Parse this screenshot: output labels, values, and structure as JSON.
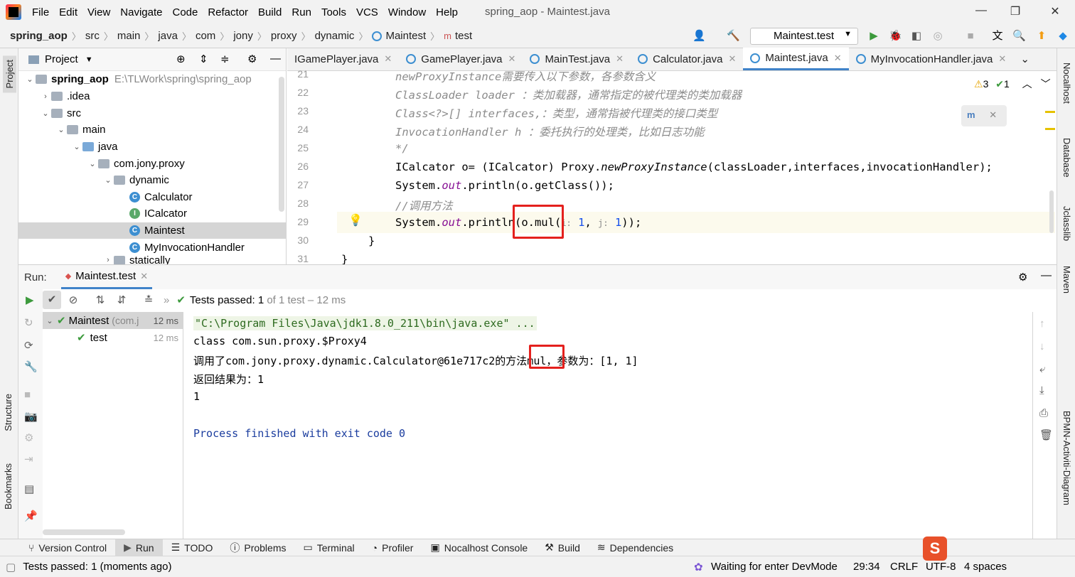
{
  "menu": [
    "File",
    "Edit",
    "View",
    "Navigate",
    "Code",
    "Refactor",
    "Build",
    "Run",
    "Tools",
    "VCS",
    "Window",
    "Help"
  ],
  "window_title": "spring_aop - Maintest.java",
  "breadcrumbs": [
    "spring_aop",
    "src",
    "main",
    "java",
    "com",
    "jony",
    "proxy",
    "dynamic",
    "Maintest",
    "test"
  ],
  "run_config": "Maintest.test",
  "project_panel": {
    "title": "Project",
    "tree": [
      {
        "label": "spring_aop",
        "extra": "E:\\TLWork\\spring\\spring_aop"
      },
      {
        "label": ".idea"
      },
      {
        "label": "src"
      },
      {
        "label": "main"
      },
      {
        "label": "java"
      },
      {
        "label": "com.jony.proxy"
      },
      {
        "label": "dynamic"
      },
      {
        "label": "Calculator"
      },
      {
        "label": "ICalcator"
      },
      {
        "label": "Maintest"
      },
      {
        "label": "MyInvocationHandler"
      },
      {
        "label": "statically"
      }
    ]
  },
  "editor_tabs": [
    "IGamePlayer.java",
    "GamePlayer.java",
    "MainTest.java",
    "Calculator.java",
    "Maintest.java",
    "MyInvocationHandler.java"
  ],
  "inspections": {
    "warnings": "3",
    "ok": "1"
  },
  "code_lines": [
    {
      "n": "21",
      "text": "newProxyInstance需要传入以下参数，各参数含义"
    },
    {
      "n": "22",
      "text": "ClassLoader loader ：类加载器，通常指定的被代理类的类加载器"
    },
    {
      "n": "23",
      "text": "Class<?>[] interfaces,：类型，通常指被代理类的接口类型"
    },
    {
      "n": "24",
      "text": "InvocationHandler h ：委托执行的处理类，比如日志功能"
    },
    {
      "n": "25",
      "text": "*/"
    },
    {
      "n": "26",
      "a": "ICalcator o= (ICalcator) Proxy.",
      "b": "newProxyInstance",
      "c": "(classLoader,interfaces,invocationHandler);"
    },
    {
      "n": "27",
      "a": "System.",
      "b": "out",
      "c": ".println(o.getClass());"
    },
    {
      "n": "28",
      "text": "//调用方法"
    },
    {
      "n": "29",
      "a": "System.",
      "b": "out",
      "c": ".println(o.mul(",
      "h1": "i:",
      "v1": "1",
      ",": ",",
      "h2": "j:",
      "v2": "1",
      "end": "));"
    },
    {
      "n": "30",
      "text": "}"
    },
    {
      "n": "31",
      "text": "}"
    }
  ],
  "run_panel": {
    "label": "Run:",
    "tab": "Maintest.test",
    "status": "Tests passed:",
    "status_count": "1",
    "status_rest": "of 1 test – 12 ms",
    "tests": [
      {
        "name": "Maintest",
        "pkg": "(com.j",
        "time": "12 ms"
      },
      {
        "name": "test",
        "time": "12 ms"
      }
    ],
    "console": [
      "\"C:\\Program Files\\Java\\jdk1.8.0_211\\bin\\java.exe\" ...",
      "class com.sun.proxy.$Proxy4",
      "调用了com.jony.proxy.dynamic.Calculator@61e717c2的方法mul，参数为：[1, 1]",
      "返回结果为：1",
      "1",
      "",
      "Process finished with exit code 0"
    ]
  },
  "bottom_tabs": [
    "Version Control",
    "Run",
    "TODO",
    "Problems",
    "Terminal",
    "Profiler",
    "Nocalhost Console",
    "Build",
    "Dependencies"
  ],
  "status_bar": {
    "message": "Tests passed: 1 (moments ago)",
    "devmode": "Waiting for enter DevMode",
    "position": "29:34",
    "line_sep": "CRLF",
    "encoding": "UTF-8",
    "indent": "4 spaces"
  },
  "right_tools": [
    "Nocalhost",
    "Database",
    "Jclasslib",
    "Maven",
    "BPMN-Activiti-Diagram"
  ],
  "left_tools": [
    "Project",
    "Structure",
    "Bookmarks"
  ]
}
